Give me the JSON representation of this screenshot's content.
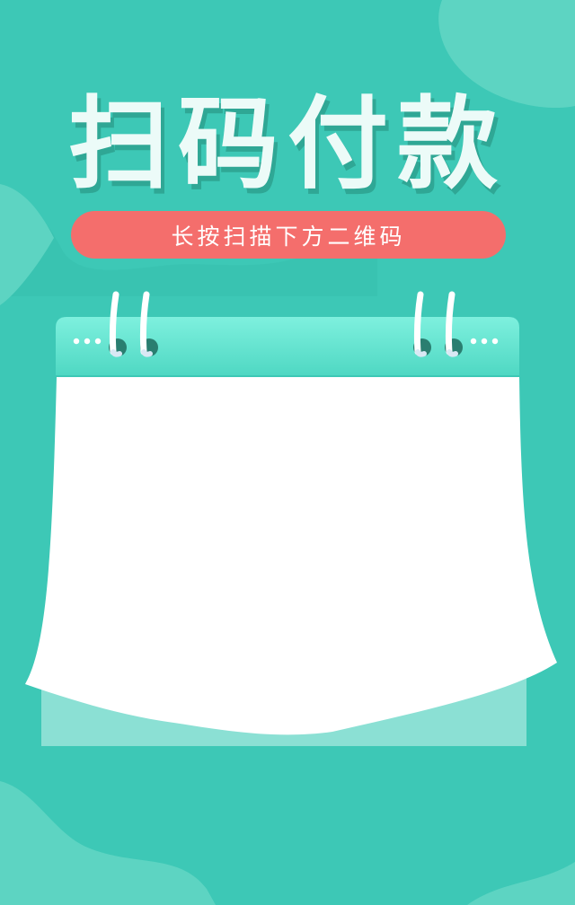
{
  "poster": {
    "title": "扫码付款",
    "subtitle": "长按扫描下方二维码"
  },
  "colors": {
    "background": "#3dc8b6",
    "light_wave": "#5dd4c2",
    "accent_pill": "#f46e6c",
    "calendar_header": "#6ee8d5",
    "paper": "#ffffff"
  }
}
